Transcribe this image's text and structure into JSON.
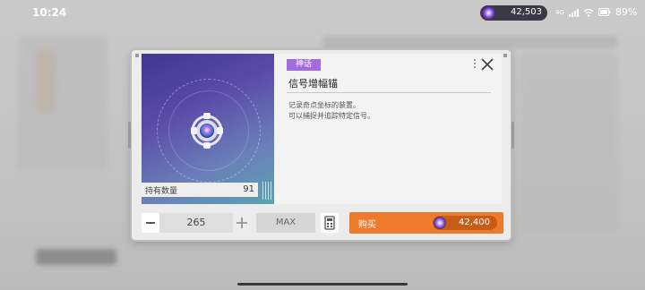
{
  "status_bar": {
    "time": "10:24",
    "currency_amount": "42,503",
    "network": "4G",
    "battery": "89%"
  },
  "dialog": {
    "rarity": "神话",
    "item_name": "信号增幅锚",
    "description_line1": "记录奇点坐标的装置。",
    "description_line2": "可以捕捉并追踪特定信号。",
    "owned_label": "持有数量",
    "owned_value": "91",
    "quantity": "265",
    "max_label": "MAX",
    "buy_label": "购买",
    "price": "42,400"
  },
  "colors": {
    "accent_orange": "#ee7a2c",
    "rarity_purple": "#a46be0",
    "card_gradient_start": "#3f3790",
    "card_gradient_end": "#5ba3b0"
  },
  "icons": {
    "item": "signal-anchor-icon",
    "currency": "crystal-gem-icon",
    "close": "close-icon",
    "calculator": "calculator-icon"
  }
}
